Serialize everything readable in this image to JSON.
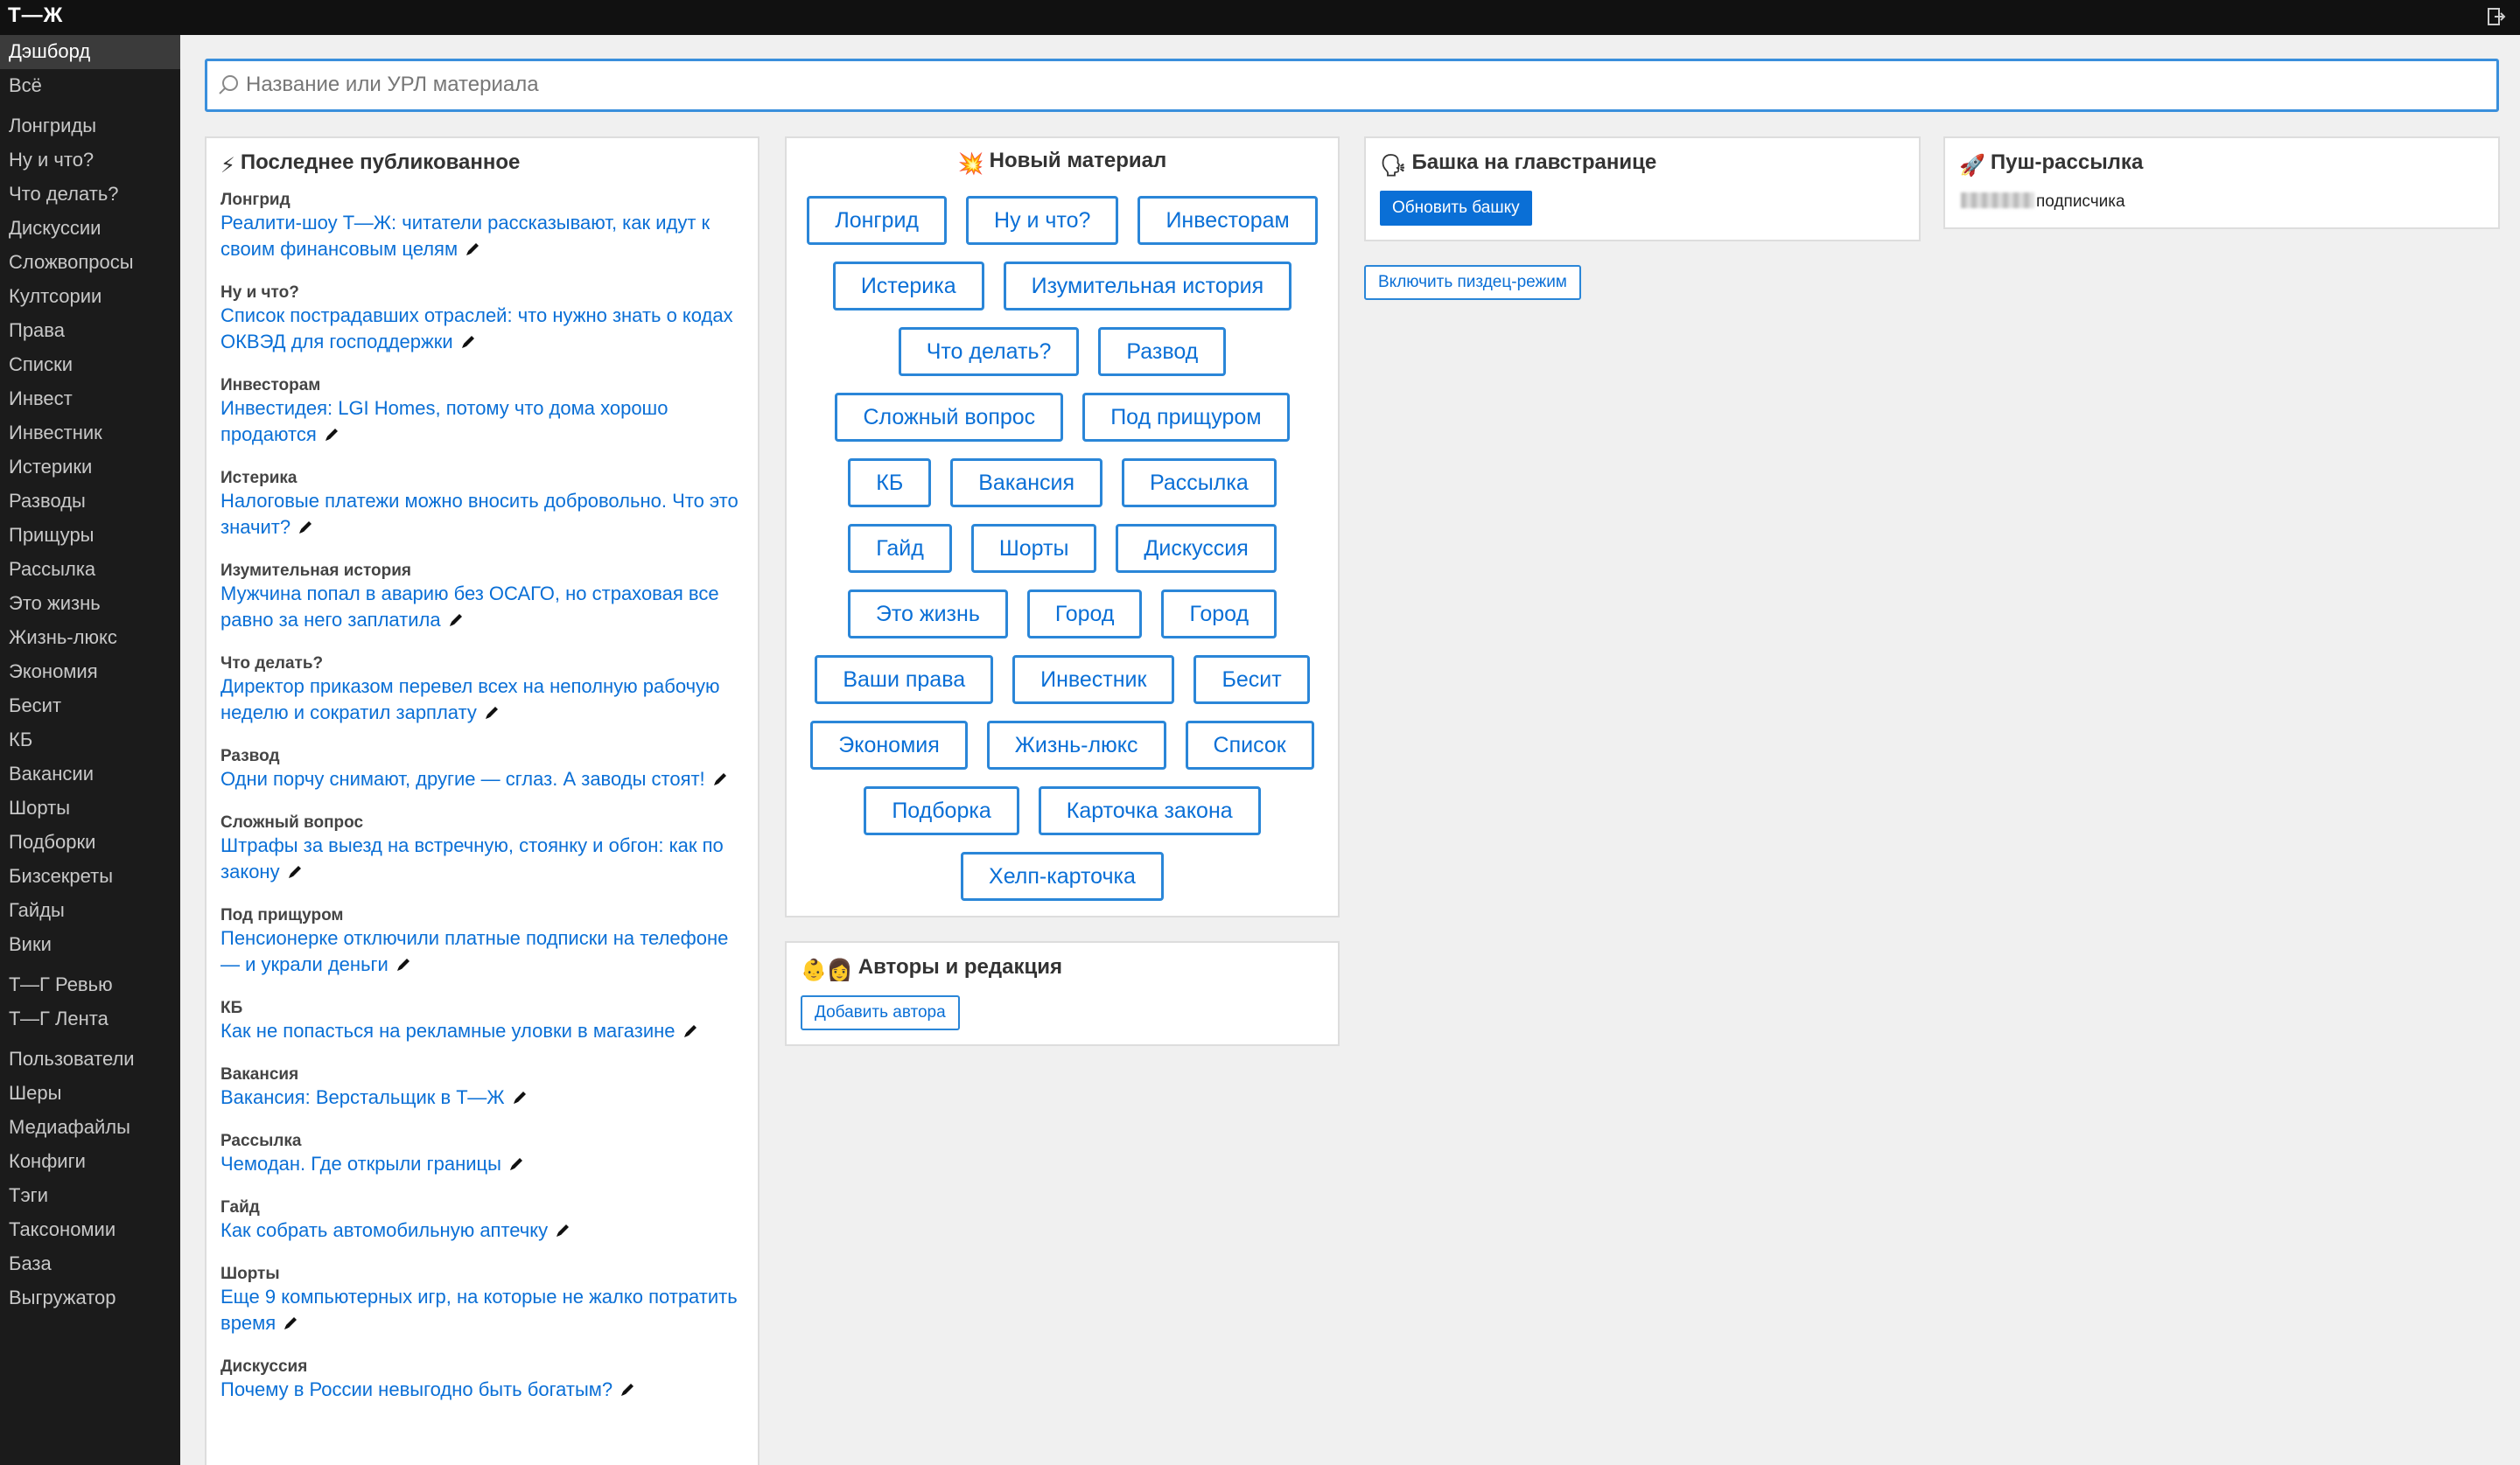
{
  "app": {
    "logo": "Т—Ж"
  },
  "sidebar": {
    "items": [
      {
        "label": "Дэшборд",
        "active": true
      },
      {
        "label": "Всё"
      },
      {
        "label": "Лонгриды",
        "gap": true
      },
      {
        "label": "Ну и что?"
      },
      {
        "label": "Что делать?"
      },
      {
        "label": "Дискуссии"
      },
      {
        "label": "Сложвопросы"
      },
      {
        "label": "Култсории"
      },
      {
        "label": "Права"
      },
      {
        "label": "Списки"
      },
      {
        "label": "Инвест"
      },
      {
        "label": "Инвестник"
      },
      {
        "label": "Истерики"
      },
      {
        "label": "Разводы"
      },
      {
        "label": "Прищуры"
      },
      {
        "label": "Рассылка"
      },
      {
        "label": "Это жизнь"
      },
      {
        "label": "Жизнь-люкс"
      },
      {
        "label": "Экономия"
      },
      {
        "label": "Бесит"
      },
      {
        "label": "КБ"
      },
      {
        "label": "Вакансии"
      },
      {
        "label": "Шорты"
      },
      {
        "label": "Подборки"
      },
      {
        "label": "Бизсекреты"
      },
      {
        "label": "Гайды"
      },
      {
        "label": "Вики"
      },
      {
        "label": "Т—Г Ревью",
        "gap": true
      },
      {
        "label": "Т—Г Лента"
      },
      {
        "label": "Пользователи",
        "gap": true
      },
      {
        "label": "Шеры"
      },
      {
        "label": "Медиафайлы"
      },
      {
        "label": "Конфиги"
      },
      {
        "label": "Тэги"
      },
      {
        "label": "Таксономии"
      },
      {
        "label": "База"
      },
      {
        "label": "Выгружатор"
      }
    ]
  },
  "search": {
    "placeholder": "Название или УРЛ материала",
    "value": ""
  },
  "last_published": {
    "icon": "⚡",
    "title": "Последнее публикованное",
    "items": [
      {
        "category": "Лонгрид",
        "title": "Реалити-шоу Т—Ж: читатели рассказывают, как идут к своим финансовым целям"
      },
      {
        "category": "Ну и что?",
        "title": "Список пострадавших отраслей: что нужно знать о кодах ОКВЭД для господдержки"
      },
      {
        "category": "Инвесторам",
        "title": "Инвестидея: LGI Homes, потому что дома хорошо продаются"
      },
      {
        "category": "Истерика",
        "title": "Налоговые платежи можно вносить добровольно. Что это значит?"
      },
      {
        "category": "Изумительная история",
        "title": "Мужчина попал в аварию без ОСАГО, но страховая все равно за него заплатила"
      },
      {
        "category": "Что делать?",
        "title": "Директор приказом перевел всех на неполную рабочую неделю и сократил зарплату"
      },
      {
        "category": "Развод",
        "title": "Одни порчу снимают, другие — сглаз. А заводы стоят!"
      },
      {
        "category": "Сложный вопрос",
        "title": "Штрафы за выезд на встречную, стоянку и обгон: как по закону"
      },
      {
        "category": "Под прищуром",
        "title": "Пенсионерке отключили платные подписки на телефоне — и украли деньги"
      },
      {
        "category": "КБ",
        "title": "Как не попасться на рекламные уловки в магазине"
      },
      {
        "category": "Вакансия",
        "title": "Вакансия: Верстальщик в Т—Ж"
      },
      {
        "category": "Рассылка",
        "title": "Чемодан. Где открыли границы"
      },
      {
        "category": "Гайд",
        "title": "Как собрать автомобильную аптечку"
      },
      {
        "category": "Шорты",
        "title": "Еще 9 компьютерных игр, на которые не жалко потратить время"
      },
      {
        "category": "Дискуссия",
        "title": "Почему в России невыгодно быть богатым?"
      }
    ]
  },
  "new_material": {
    "icon": "💥",
    "title": "Новый материал",
    "rows": [
      [
        "Лонгрид",
        "Ну и что?",
        "Инвесторам"
      ],
      [
        "Истерика",
        "Изумительная история"
      ],
      [
        "Что делать?",
        "Развод"
      ],
      [
        "Сложный вопрос",
        "Под прищуром"
      ],
      [
        "КБ",
        "Вакансия",
        "Рассылка"
      ],
      [
        "Гайд",
        "Шорты",
        "Дискуссия"
      ],
      [
        "Это жизнь",
        "Город",
        "Город"
      ],
      [
        "Ваши права",
        "Инвестник",
        "Бесит"
      ],
      [
        "Экономия",
        "Жизнь-люкс",
        "Список"
      ],
      [
        "Подборка",
        "Карточка закона"
      ],
      [
        "Хелп-карточка"
      ]
    ]
  },
  "authors": {
    "icon": "👶👩",
    "title": "Авторы и редакция",
    "add_label": "Добавить автора"
  },
  "bashka": {
    "icon": "🗣",
    "title": "Башка на главстранице",
    "update_label": "Обновить башку",
    "mode_label": "Включить пиздец-режим"
  },
  "push": {
    "icon": "🚀",
    "title": "Пуш-рассылка",
    "count_suffix": "подписчика"
  },
  "colors": {
    "accent": "#0a6fd6",
    "sidebar_bg": "#1b1b1b",
    "topbar_bg": "#111111"
  },
  "icons": {
    "logout": "logout-icon",
    "search": "search-icon",
    "edit": "pencil-icon"
  }
}
